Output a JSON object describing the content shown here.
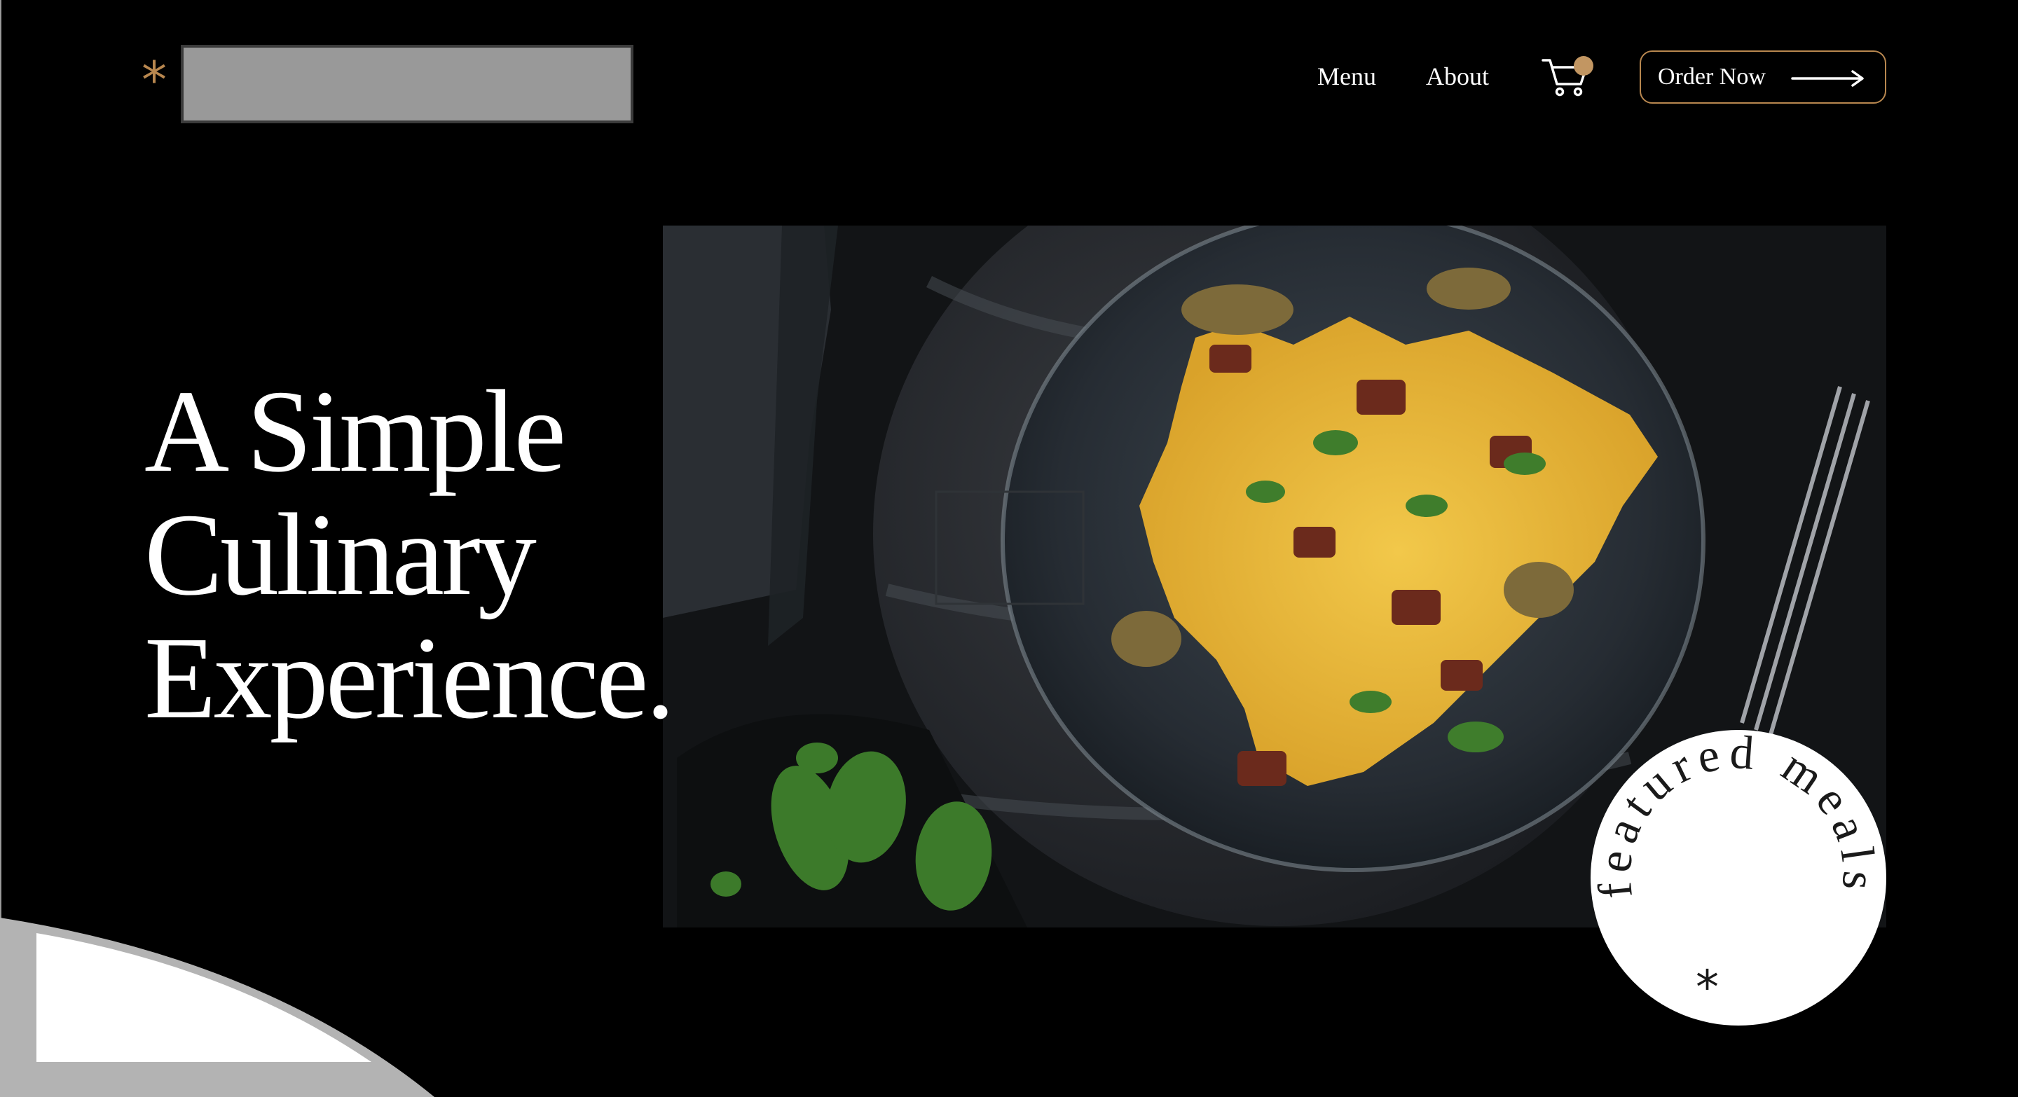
{
  "header": {
    "logo_icon": "asterisk-icon",
    "nav": [
      {
        "label": "Menu"
      },
      {
        "label": "About"
      }
    ],
    "cart_icon": "shopping-cart-icon",
    "order_button": {
      "label": "Order Now",
      "icon": "long-arrow-right-icon"
    }
  },
  "hero": {
    "title_lines": [
      "A Simple",
      "Culinary",
      "Experience."
    ],
    "image_description_icon": "pasta-dish-photo"
  },
  "badge": {
    "text": "featured meals",
    "icon": "asterisk-icon"
  },
  "colors": {
    "background": "#000000",
    "accent": "#b8874f",
    "text": "#ffffff",
    "badge_bg": "#ffffff"
  }
}
